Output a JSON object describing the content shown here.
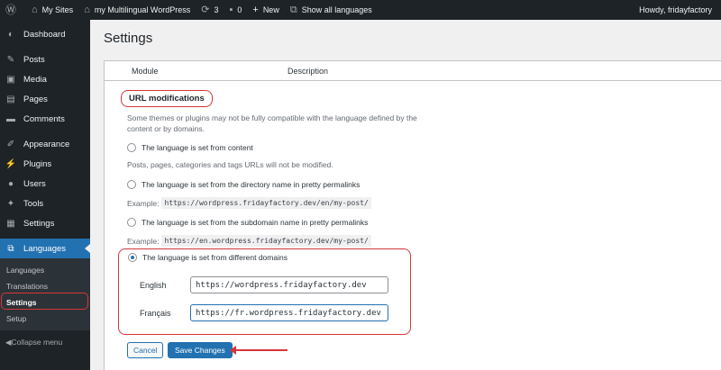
{
  "adminbar": {
    "my_sites": "My Sites",
    "site_name": "my Multilingual WordPress",
    "updates_count": "3",
    "comments_count": "0",
    "new_label": "New",
    "show_all_languages": "Show all languages",
    "howdy": "Howdy, fridayfactory"
  },
  "sidebar": {
    "items": [
      {
        "label": "Dashboard",
        "icon": "dashboard-icon"
      },
      {
        "label": "Posts",
        "icon": "pin-icon"
      },
      {
        "label": "Media",
        "icon": "media-icon"
      },
      {
        "label": "Pages",
        "icon": "pages-icon"
      },
      {
        "label": "Comments",
        "icon": "comment-icon"
      },
      {
        "label": "Appearance",
        "icon": "brush-icon"
      },
      {
        "label": "Plugins",
        "icon": "plugin-icon"
      },
      {
        "label": "Users",
        "icon": "user-icon"
      },
      {
        "label": "Tools",
        "icon": "wrench-icon"
      },
      {
        "label": "Settings",
        "icon": "settings-icon"
      },
      {
        "label": "Languages",
        "icon": "translation-icon"
      }
    ],
    "submenu": [
      "Languages",
      "Translations",
      "Settings",
      "Setup"
    ],
    "collapse": "Collapse menu"
  },
  "page": {
    "title": "Settings",
    "col_module": "Module",
    "col_description": "Description"
  },
  "url_mod": {
    "title": "URL modifications",
    "description": "Some themes or plugins may not be fully compatible with the language defined by the content or by domains.",
    "opt_content": "The language is set from content",
    "note_content": "Posts, pages, categories and tags URLs will not be modified.",
    "opt_directory": "The language is set from the directory name in pretty permalinks",
    "example_label": "Example:",
    "example_directory": "https://wordpress.fridayfactory.dev/en/my-post/",
    "opt_subdomain": "The language is set from the subdomain name in pretty permalinks",
    "example_subdomain": "https://en.wordpress.fridayfactory.dev/my-post/",
    "opt_domains": "The language is set from different domains",
    "english_label": "English",
    "english_value": "https://wordpress.fridayfactory.dev",
    "french_label": "Français",
    "french_value": "https://fr.wordpress.fridayfactory.dev"
  },
  "buttons": {
    "cancel": "Cancel",
    "save": "Save Changes"
  },
  "colors": {
    "admin_dark": "#1d2327",
    "accent_blue": "#2271b1",
    "annotation_red": "#d63638"
  }
}
